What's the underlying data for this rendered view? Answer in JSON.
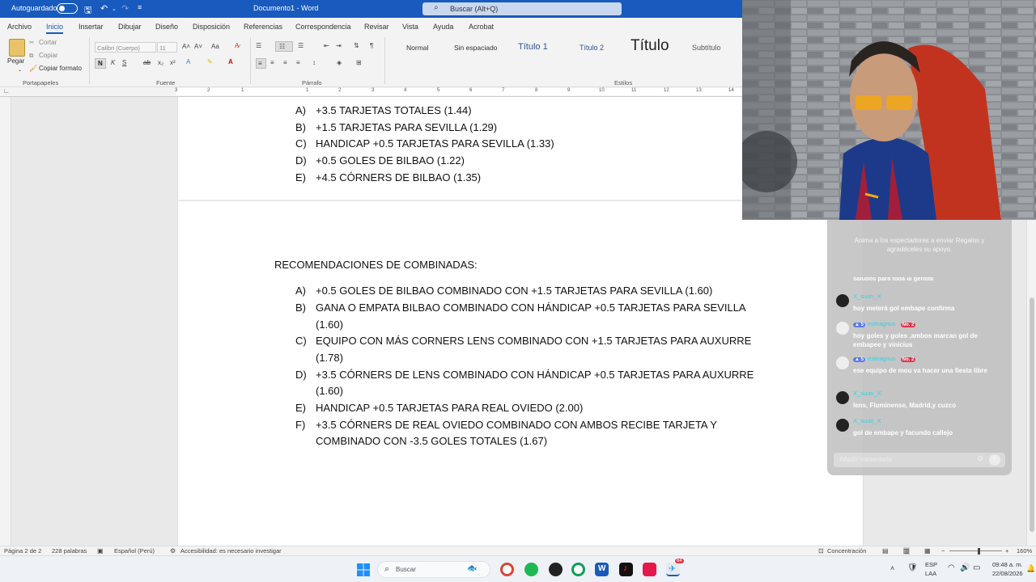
{
  "titlebar": {
    "autosave_label": "Autoguardado",
    "document_title": "Documento1 - Word",
    "search_placeholder": "Buscar (Alt+Q)"
  },
  "ribbon": {
    "tabs": [
      "Archivo",
      "Inicio",
      "Insertar",
      "Dibujar",
      "Diseño",
      "Disposición",
      "Referencias",
      "Correspondencia",
      "Revisar",
      "Vista",
      "Ayuda",
      "Acrobat"
    ],
    "active_tab": "Inicio",
    "clipboard": {
      "paste": "Pegar",
      "cut": "Cortar",
      "copy": "Copiar",
      "format_painter": "Copiar formato",
      "group_label": "Portapapeles"
    },
    "font": {
      "name": "Calibri (Cuerpo)",
      "size": "11",
      "group_label": "Fuente"
    },
    "paragraph_label": "Párrafo",
    "styles": {
      "items": [
        "Normal",
        "Sin espaciado",
        "Título 1",
        "Título 2",
        "Título",
        "Subtítulo"
      ],
      "group_label": "Estilos"
    }
  },
  "ruler": {
    "numbers": [
      "3",
      "2",
      "1",
      "1",
      "2",
      "3",
      "4",
      "5",
      "6",
      "7",
      "8",
      "9",
      "10",
      "11",
      "12",
      "13",
      "14"
    ]
  },
  "document": {
    "list_top": [
      {
        "letter": "A)",
        "text": "+3.5 TARJETAS TOTALES (1.44)"
      },
      {
        "letter": "B)",
        "text": "+1.5 TARJETAS PARA SEVILLA (1.29)"
      },
      {
        "letter": "C)",
        "text": "HANDICAP +0.5 TARJETAS PARA SEVILLA (1.33)"
      },
      {
        "letter": "D)",
        "text": "+0.5 GOLES DE BILBAO (1.22)"
      },
      {
        "letter": "E)",
        "text": "+4.5 CÓRNERS DE BILBAO (1.35)"
      }
    ],
    "heading": "RECOMENDACIONES DE COMBINADAS:",
    "list_combined": [
      {
        "letter": "A)",
        "lines": [
          "+0.5 GOLES DE BILBAO COMBINADO CON +1.5 TARJETAS PARA SEVILLA (1.60)"
        ]
      },
      {
        "letter": "B)",
        "lines": [
          "GANA O EMPATA BILBAO COMBINADO CON HÁNDICAP +0.5 TARJETAS PARA SEVILLA",
          "(1.60)"
        ]
      },
      {
        "letter": "C)",
        "lines": [
          "EQUIPO CON MÁS CORNERS LENS COMBINADO CON +1.5 TARJETAS PARA AUXURRE",
          "(1.78)"
        ]
      },
      {
        "letter": "D)",
        "lines": [
          "+3.5 CÓRNERS DE LENS COMBINADO CON HÁNDICAP +0.5 TARJETAS PARA AUXURRE",
          "(1.60)"
        ]
      },
      {
        "letter": "E)",
        "lines": [
          "HANDICAP +0.5 TARJETAS PARA REAL OVIEDO (2.00)"
        ]
      },
      {
        "letter": "F)",
        "lines": [
          "+3.5 CÓRNERS DE REAL OVIEDO COMBINADO CON AMBOS RECIBE TARJETA Y",
          "COMBINADO CON -3.5 GOLES TOTALES (1.67)"
        ]
      }
    ]
  },
  "chat": {
    "banner": "Anima a los espectadores a enviar Regalos y agradéceles su apoyo.",
    "partial_text": "saludos para toda la gentita",
    "messages": [
      {
        "user": "X_suun_X",
        "level": "",
        "rank": "",
        "text": "hoy meterá gol embape confirma",
        "avatar": "dark"
      },
      {
        "user": "esteagnus",
        "level": "5",
        "rank": "No. 2",
        "text": "hoy goles y goles ,ambos marcan gol de embapee y vinicius",
        "avatar": "light"
      },
      {
        "user": "esteagnus",
        "level": "5",
        "rank": "No. 2",
        "text": "ese equipo de mou va hacer una fiesta libre",
        "avatar": "light"
      },
      {
        "user": "X_suun_X",
        "level": "",
        "rank": "",
        "text": "lens, Fluminense, Madrid,y cuzco",
        "avatar": "dark"
      },
      {
        "user": "X_suun_X",
        "level": "",
        "rank": "",
        "text": "gol de embape y facundo callejo",
        "avatar": "dark"
      }
    ],
    "input_placeholder": "Añadir comentario"
  },
  "statusbar": {
    "page": "Página 2 de 2",
    "words": "228 palabras",
    "language": "Español (Perú)",
    "accessibility": "Accesibilidad: es necesario investigar",
    "focus": "Concentración",
    "zoom": "160%"
  },
  "taskbar": {
    "search": "Buscar",
    "lang_primary": "ESP",
    "lang_secondary": "LAA",
    "time": "09:48 a. m.",
    "date": "22/08/2026",
    "notification_count": "64"
  },
  "colors": {
    "word_blue": "#185abd",
    "chat_username": "#2fd3e6",
    "badge_level": "#5b7cf0",
    "badge_rank": "#e0364d"
  }
}
